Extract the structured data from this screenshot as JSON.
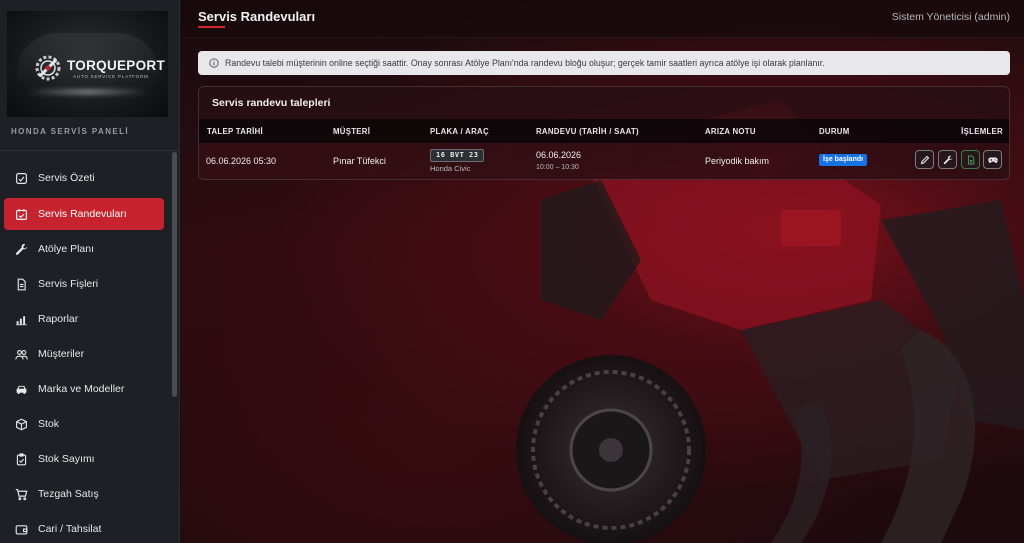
{
  "brand": {
    "name": "TORQUEPORT",
    "tagline": "AUTO SERVICE PLATFORM",
    "panel_label": "HONDA SERVİS PANELİ"
  },
  "sidebar": {
    "items": [
      {
        "label": "Servis Özeti",
        "icon": "car-check-icon",
        "active": false
      },
      {
        "label": "Servis Randevuları",
        "icon": "calendar-check-icon",
        "active": true
      },
      {
        "label": "Atölye Planı",
        "icon": "wrench-icon",
        "active": false
      },
      {
        "label": "Servis Fişleri",
        "icon": "document-icon",
        "active": false
      },
      {
        "label": "Raporlar",
        "icon": "bar-chart-icon",
        "active": false
      },
      {
        "label": "Müşteriler",
        "icon": "users-icon",
        "active": false
      },
      {
        "label": "Marka ve Modeller",
        "icon": "car-icon",
        "active": false
      },
      {
        "label": "Stok",
        "icon": "box-icon",
        "active": false
      },
      {
        "label": "Stok Sayımı",
        "icon": "clipboard-check-icon",
        "active": false
      },
      {
        "label": "Tezgah Satış",
        "icon": "cart-icon",
        "active": false
      },
      {
        "label": "Cari / Tahsilat",
        "icon": "wallet-icon",
        "active": false
      }
    ]
  },
  "header": {
    "title": "Servis Randevuları",
    "user": "Sistem Yöneticisi (admin)"
  },
  "info": {
    "text": "Randevu talebi müşterinin online seçtiği saattir. Onay sonrası Atölye Planı'nda randevu bloğu oluşur; gerçek tamir saatleri ayrıca atölye işi olarak planlanır."
  },
  "table": {
    "title": "Servis randevu talepleri",
    "columns": [
      "TALEP TARİHİ",
      "MÜŞTERİ",
      "PLAKA / ARAÇ",
      "RANDEVU (TARİH / SAAT)",
      "ARIZA NOTU",
      "DURUM",
      "İŞLEMLER"
    ],
    "rows": [
      {
        "request_date": "06.06.2026 05:30",
        "customer": "Pınar Tüfekci",
        "plate": "16 BVT 23",
        "vehicle": "Honda Civic",
        "appointment_date": "06.06.2026",
        "appointment_time": "10:00 – 10:30",
        "fault_note": "Periyodik bakım",
        "status": "İşe başlandı",
        "actions": [
          "edit-icon",
          "wrench-icon",
          "document-icon",
          "gamepad-icon"
        ]
      }
    ]
  },
  "colors": {
    "accent": "#c6232f",
    "status_blue": "#1673e6",
    "sidebar_bg": "#1e2025"
  }
}
